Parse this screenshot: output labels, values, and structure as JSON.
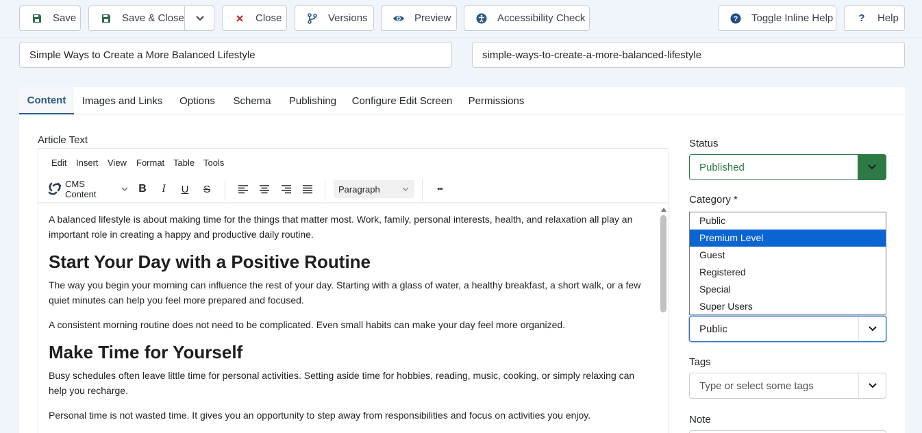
{
  "toolbar": {
    "save": "Save",
    "save_close": "Save & Close",
    "close": "Close",
    "versions": "Versions",
    "preview": "Preview",
    "accessibility": "Accessibility Check",
    "toggle_help": "Toggle Inline Help",
    "help": "Help"
  },
  "article": {
    "title": "Simple Ways to Create a More Balanced Lifestyle",
    "alias": "simple-ways-to-create-a-more-balanced-lifestyle"
  },
  "tabs": [
    "Content",
    "Images and Links",
    "Options",
    "Schema",
    "Publishing",
    "Configure Edit Screen",
    "Permissions"
  ],
  "editor": {
    "label": "Article Text",
    "menu": [
      "Edit",
      "Insert",
      "View",
      "Format",
      "Table",
      "Tools"
    ],
    "cms_content": "CMS Content",
    "block_format": "Paragraph",
    "more": "•••",
    "paragraphs": {
      "p1": "A balanced lifestyle is about making time for the things that matter most. Work, family, personal interests, health, and relaxation all play an important role in creating a happy and productive daily routine.",
      "h1": "Start Your Day with a Positive Routine",
      "p2": "The way you begin your morning can influence the rest of your day. Starting with a glass of water, a healthy breakfast, a short walk, or a few quiet minutes can help you feel more prepared and focused.",
      "p3": "A consistent morning routine does not need to be complicated. Even small habits can make your day feel more organized.",
      "h2": "Make Time for Yourself",
      "p4": "Busy schedules often leave little time for personal activities. Setting aside time for hobbies, reading, music, cooking, or simply relaxing can help you recharge.",
      "p5": "Personal time is not wasted time. It gives you an opportunity to step away from responsibilities and focus on activities you enjoy."
    }
  },
  "sidebar": {
    "status_label": "Status",
    "status_value": "Published",
    "category_label": "Category *",
    "access_options": [
      "Public",
      "Premium Level",
      "Guest",
      "Registered",
      "Special",
      "Super Users"
    ],
    "access_highlighted": "Premium Level",
    "access_value": "Public",
    "tags_label": "Tags",
    "tags_placeholder": "Type or select some tags",
    "note_label": "Note"
  },
  "colors": {
    "accent": "#2a5a8a",
    "status_green": "#2d7a46",
    "option_highlight": "#0a64d2",
    "close_red": "#c52827"
  }
}
